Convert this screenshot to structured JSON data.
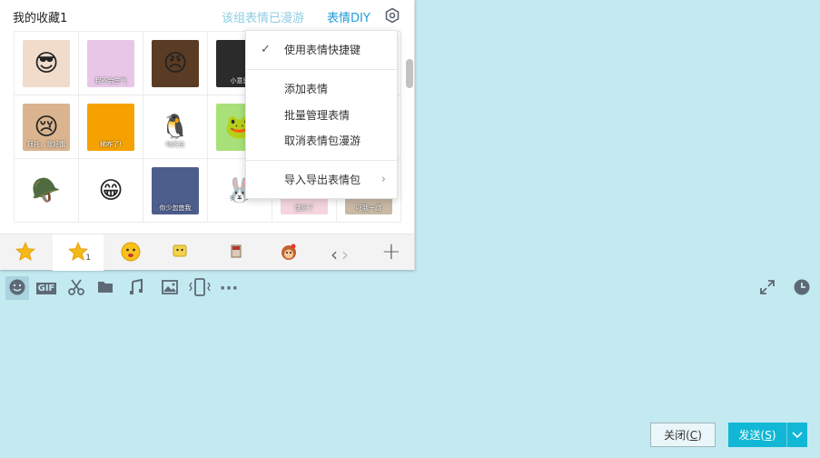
{
  "panel": {
    "title": "我的收藏1",
    "roam_text": "该组表情已漫游",
    "diy_link": "表情DIY",
    "stickers": [
      {
        "icon": "baby-sunglasses-sticker",
        "bg": "#f1dccc",
        "mark": "😎",
        "caption": ""
      },
      {
        "icon": "purple-wig-sticker",
        "bg": "#e8c6e7",
        "mark": "",
        "caption": "我不会生气"
      },
      {
        "icon": "angry-man-sticker",
        "bg": "#5a3b24",
        "mark": "😠",
        "caption": ""
      },
      {
        "icon": "text-sticker",
        "bg": "#2b2b2b",
        "mark": "",
        "caption": "小意思"
      },
      {
        "icon": "hidden-sticker",
        "bg": "#eeeeee",
        "mark": "",
        "caption": ""
      },
      {
        "icon": "hidden-sticker",
        "bg": "#eeeeee",
        "mark": "",
        "caption": ""
      },
      {
        "icon": "crying-baby-sticker",
        "bg": "#d9b48f",
        "mark": "😢",
        "caption": "拜托，我好饿"
      },
      {
        "icon": "red-creature-sticker",
        "bg": "#f5a200",
        "mark": "",
        "caption": "稀咋了!"
      },
      {
        "icon": "penguin-sticker",
        "bg": "#ffffff",
        "mark": "🐧",
        "caption": "咕的白"
      },
      {
        "icon": "frog-sticker",
        "bg": "#a8e07a",
        "mark": "🐸",
        "caption": ""
      },
      {
        "icon": "hidden-sticker",
        "bg": "#eeeeee",
        "mark": "",
        "caption": ""
      },
      {
        "icon": "gray-sticker",
        "bg": "#bfc6cc",
        "mark": "",
        "caption": ""
      },
      {
        "icon": "green-helmet-sticker",
        "bg": "#ffffff",
        "mark": "🪖",
        "caption": ""
      },
      {
        "icon": "yellow-grin-sticker",
        "bg": "#ffffff",
        "mark": "😁",
        "caption": ""
      },
      {
        "icon": "old-man-sticker",
        "bg": "#4d5e8c",
        "mark": "",
        "caption": "你少忽悠我"
      },
      {
        "icon": "white-rabbit-sticker",
        "bg": "#ffffff",
        "mark": "🐰",
        "caption": ""
      },
      {
        "icon": "pink-creature-sticker",
        "bg": "#f4d5dd",
        "mark": "",
        "caption": "饿死了"
      },
      {
        "icon": "scared-face-sticker",
        "bg": "#c8b8a5",
        "mark": "",
        "caption": "吓我一跳"
      }
    ]
  },
  "menu": {
    "items": [
      {
        "label": "使用表情快捷键",
        "checked": true
      },
      {
        "label": "添加表情"
      },
      {
        "label": "批量管理表情"
      },
      {
        "label": "取消表情包漫游"
      },
      {
        "label": "导入导出表情包"
      }
    ]
  },
  "tabs": [
    {
      "name": "star-tab",
      "badge": ""
    },
    {
      "name": "star-favorites-tab",
      "badge": "1"
    },
    {
      "name": "emoji-face-tab",
      "badge": ""
    },
    {
      "name": "pack-tab-1",
      "badge": ""
    },
    {
      "name": "pack-tab-2",
      "badge": ""
    },
    {
      "name": "monkey-pack-tab",
      "badge": ""
    }
  ],
  "tabnav": {
    "prev": "‹",
    "next": "›",
    "add": "+"
  },
  "toolbar": {
    "gif_label": "GIF",
    "more": "···"
  },
  "buttons": {
    "close_text": "关闭(",
    "close_key": "C",
    "close_end": ")",
    "send_text": "发送(",
    "send_key": "S",
    "send_end": ")"
  },
  "colors": {
    "background": "#c3e9f1",
    "accent": "#12b7d5",
    "link": "#1e9bd7"
  }
}
